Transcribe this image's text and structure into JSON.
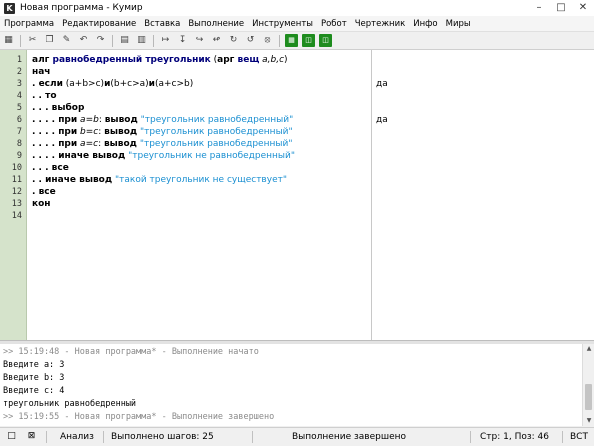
{
  "window": {
    "title": "Новая программа - Кумир",
    "app_icon": "K"
  },
  "menu": [
    "Программа",
    "Редактирование",
    "Вставка",
    "Выполнение",
    "Инструменты",
    "Робот",
    "Чертежник",
    "Инфо",
    "Миры"
  ],
  "editor": {
    "line_numbers": [
      "1",
      "2",
      "3",
      "4",
      "5",
      "6",
      "7",
      "8",
      "9",
      "10",
      "11",
      "12",
      "13",
      "14"
    ],
    "lines": [
      [
        {
          "t": "алг ",
          "c": "kw"
        },
        {
          "t": "равнобедренный треугольник",
          "c": "kwb"
        },
        {
          "t": " (",
          "c": ""
        },
        {
          "t": "арг ",
          "c": "kw"
        },
        {
          "t": "вещ",
          "c": "kwb"
        },
        {
          "t": " a,b,c",
          "c": "it"
        },
        {
          "t": ")",
          "c": ""
        }
      ],
      [
        {
          "t": "нач",
          "c": "kw"
        }
      ],
      [
        {
          "t": ". ",
          "c": "kw"
        },
        {
          "t": "если",
          "c": "kw"
        },
        {
          "t": " (a+b>c)",
          "c": ""
        },
        {
          "t": "и",
          "c": "kw"
        },
        {
          "t": "(b+c>a)",
          "c": ""
        },
        {
          "t": "и",
          "c": "kw"
        },
        {
          "t": "(a+c>b)",
          "c": ""
        }
      ],
      [
        {
          "t": ". . ",
          "c": "kw"
        },
        {
          "t": "то",
          "c": "kw"
        }
      ],
      [
        {
          "t": ". . . ",
          "c": "kw"
        },
        {
          "t": "выбор",
          "c": "kw"
        }
      ],
      [
        {
          "t": ". . . . ",
          "c": "kw"
        },
        {
          "t": "при",
          "c": "kw"
        },
        {
          "t": " a=b",
          "c": "it"
        },
        {
          "t": ": ",
          "c": ""
        },
        {
          "t": "вывод",
          "c": "kw"
        },
        {
          "t": " ",
          "c": ""
        },
        {
          "t": "\"треугольник равнобедренный\"",
          "c": "str"
        }
      ],
      [
        {
          "t": ". . . . ",
          "c": "kw"
        },
        {
          "t": "при",
          "c": "kw"
        },
        {
          "t": " b=c",
          "c": "it"
        },
        {
          "t": ": ",
          "c": ""
        },
        {
          "t": "вывод",
          "c": "kw"
        },
        {
          "t": " ",
          "c": ""
        },
        {
          "t": "\"треугольник равнобедренный\"",
          "c": "str"
        }
      ],
      [
        {
          "t": ". . . . ",
          "c": "kw"
        },
        {
          "t": "при",
          "c": "kw"
        },
        {
          "t": " a=c",
          "c": "it"
        },
        {
          "t": ": ",
          "c": ""
        },
        {
          "t": "вывод",
          "c": "kw"
        },
        {
          "t": " ",
          "c": ""
        },
        {
          "t": "\"треугольник равнобедренный\"",
          "c": "str"
        }
      ],
      [
        {
          "t": ". . . . ",
          "c": "kw"
        },
        {
          "t": "иначе вывод",
          "c": "kw"
        },
        {
          "t": " ",
          "c": ""
        },
        {
          "t": "\"треугольник не равнобедренный\"",
          "c": "str"
        }
      ],
      [
        {
          "t": ". . . ",
          "c": "kw"
        },
        {
          "t": "все",
          "c": "kw"
        }
      ],
      [
        {
          "t": ". . ",
          "c": "kw"
        },
        {
          "t": "иначе вывод",
          "c": "kw"
        },
        {
          "t": " ",
          "c": ""
        },
        {
          "t": "\"такой треугольник не существует\"",
          "c": "str"
        }
      ],
      [
        {
          "t": ". ",
          "c": "kw"
        },
        {
          "t": "все",
          "c": "kw"
        }
      ],
      [
        {
          "t": "кон",
          "c": "kw"
        }
      ],
      []
    ],
    "margin_values": [
      {
        "line": 3,
        "text": "да"
      },
      {
        "line": 6,
        "text": "да"
      }
    ]
  },
  "console": {
    "lines": [
      {
        "text": ">> 15:19:48 - Новая программа* - Выполнение начато",
        "gray": true
      },
      {
        "text": "Введите a: 3",
        "gray": false
      },
      {
        "text": "Введите b: 3",
        "gray": false
      },
      {
        "text": "Введите c: 4",
        "gray": false
      },
      {
        "text": "треугольник равнобедренный",
        "gray": false
      },
      {
        "text": ">> 15:19:55 - Новая программа* - Выполнение завершено",
        "gray": true
      }
    ]
  },
  "status": {
    "mode": "Анализ",
    "steps": "Выполнено шагов: 25",
    "state": "Выполнение завершено",
    "position": "Стр: 1, Поз: 46",
    "insert": "ВСТ"
  }
}
